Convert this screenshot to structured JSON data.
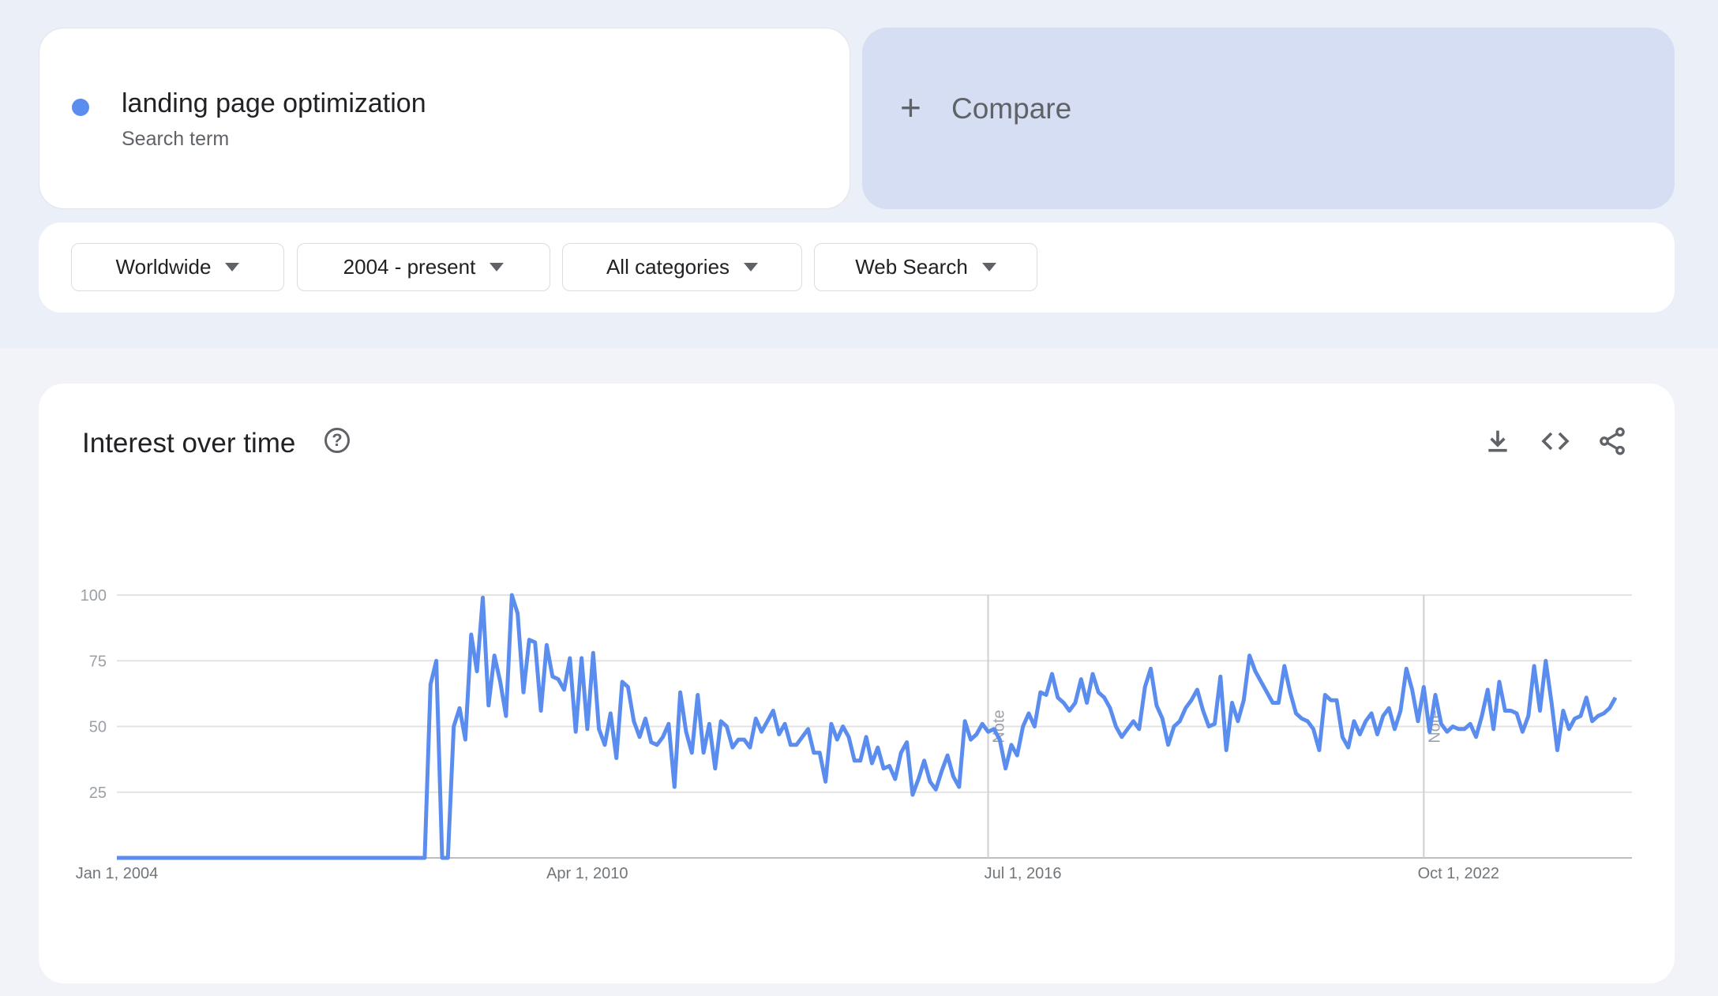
{
  "search": {
    "term": "landing page optimization",
    "subtitle": "Search term",
    "color": "#5b8def"
  },
  "compare": {
    "label": "Compare",
    "icon": "plus-icon"
  },
  "filters": [
    {
      "label": "Worldwide"
    },
    {
      "label": "2004 - present"
    },
    {
      "label": "All categories"
    },
    {
      "label": "Web Search"
    }
  ],
  "chart_card": {
    "title": "Interest over time",
    "help_icon": "help-circle-icon",
    "tools": [
      "download-icon",
      "embed-code-icon",
      "share-icon"
    ]
  },
  "chart_data": {
    "type": "line",
    "title": "Interest over time",
    "x_start": "2004-01-01",
    "x_interval": "month",
    "x_ticks": [
      "Jan 1, 2004",
      "Apr 1, 2010",
      "Jul 1, 2016",
      "Oct 1, 2022"
    ],
    "y_ticks": [
      100,
      75,
      50,
      25
    ],
    "ylim": [
      0,
      100
    ],
    "grid": true,
    "notes": [
      {
        "date": "Jul 1, 2016",
        "label": "Note"
      },
      {
        "date": "Oct 1, 2022",
        "label": "Note"
      }
    ],
    "series": [
      {
        "color": "#5b8def",
        "values": [
          0,
          0,
          0,
          0,
          0,
          0,
          0,
          0,
          0,
          0,
          0,
          0,
          0,
          0,
          0,
          0,
          0,
          0,
          0,
          0,
          0,
          0,
          0,
          0,
          0,
          0,
          0,
          0,
          0,
          0,
          0,
          0,
          0,
          0,
          0,
          0,
          0,
          0,
          0,
          0,
          0,
          0,
          0,
          0,
          0,
          0,
          0,
          0,
          0,
          0,
          0,
          0,
          0,
          0,
          66,
          75,
          0,
          0,
          50,
          57,
          45,
          85,
          71,
          99,
          58,
          77,
          67,
          54,
          100,
          93,
          63,
          83,
          82,
          56,
          81,
          69,
          68,
          64,
          76,
          48,
          76,
          49,
          78,
          49,
          43,
          55,
          38,
          67,
          65,
          52,
          46,
          53,
          44,
          43,
          46,
          51,
          27,
          63,
          48,
          40,
          62,
          40,
          51,
          34,
          52,
          50,
          42,
          45,
          45,
          42,
          53,
          48,
          52,
          56,
          47,
          51,
          43,
          43,
          46,
          49,
          40,
          40,
          29,
          51,
          45,
          50,
          46,
          37,
          37,
          46,
          36,
          42,
          34,
          35,
          30,
          40,
          44,
          24,
          30,
          37,
          29,
          26,
          33,
          39,
          31,
          27,
          52,
          45,
          47,
          51,
          48,
          49,
          45,
          34,
          43,
          39,
          50,
          55,
          50,
          63,
          62,
          70,
          61,
          59,
          56,
          59,
          68,
          59,
          70,
          63,
          61,
          57,
          50,
          46,
          49,
          52,
          49,
          65,
          72,
          58,
          53,
          43,
          50,
          52,
          57,
          60,
          64,
          56,
          50,
          51,
          69,
          41,
          59,
          52,
          60,
          77,
          71,
          67,
          63,
          59,
          59,
          73,
          63,
          55,
          53,
          52,
          49,
          41,
          62,
          60,
          60,
          46,
          42,
          52,
          47,
          52,
          55,
          47,
          54,
          57,
          49,
          56,
          72,
          64,
          52,
          65,
          48,
          62,
          51,
          48,
          50,
          49,
          49,
          51,
          46,
          54,
          64,
          49,
          67,
          56,
          56,
          55,
          48,
          54,
          73,
          56,
          75,
          59,
          41,
          56,
          49,
          53,
          54,
          61,
          52,
          54,
          55,
          57,
          61
        ]
      }
    ]
  }
}
